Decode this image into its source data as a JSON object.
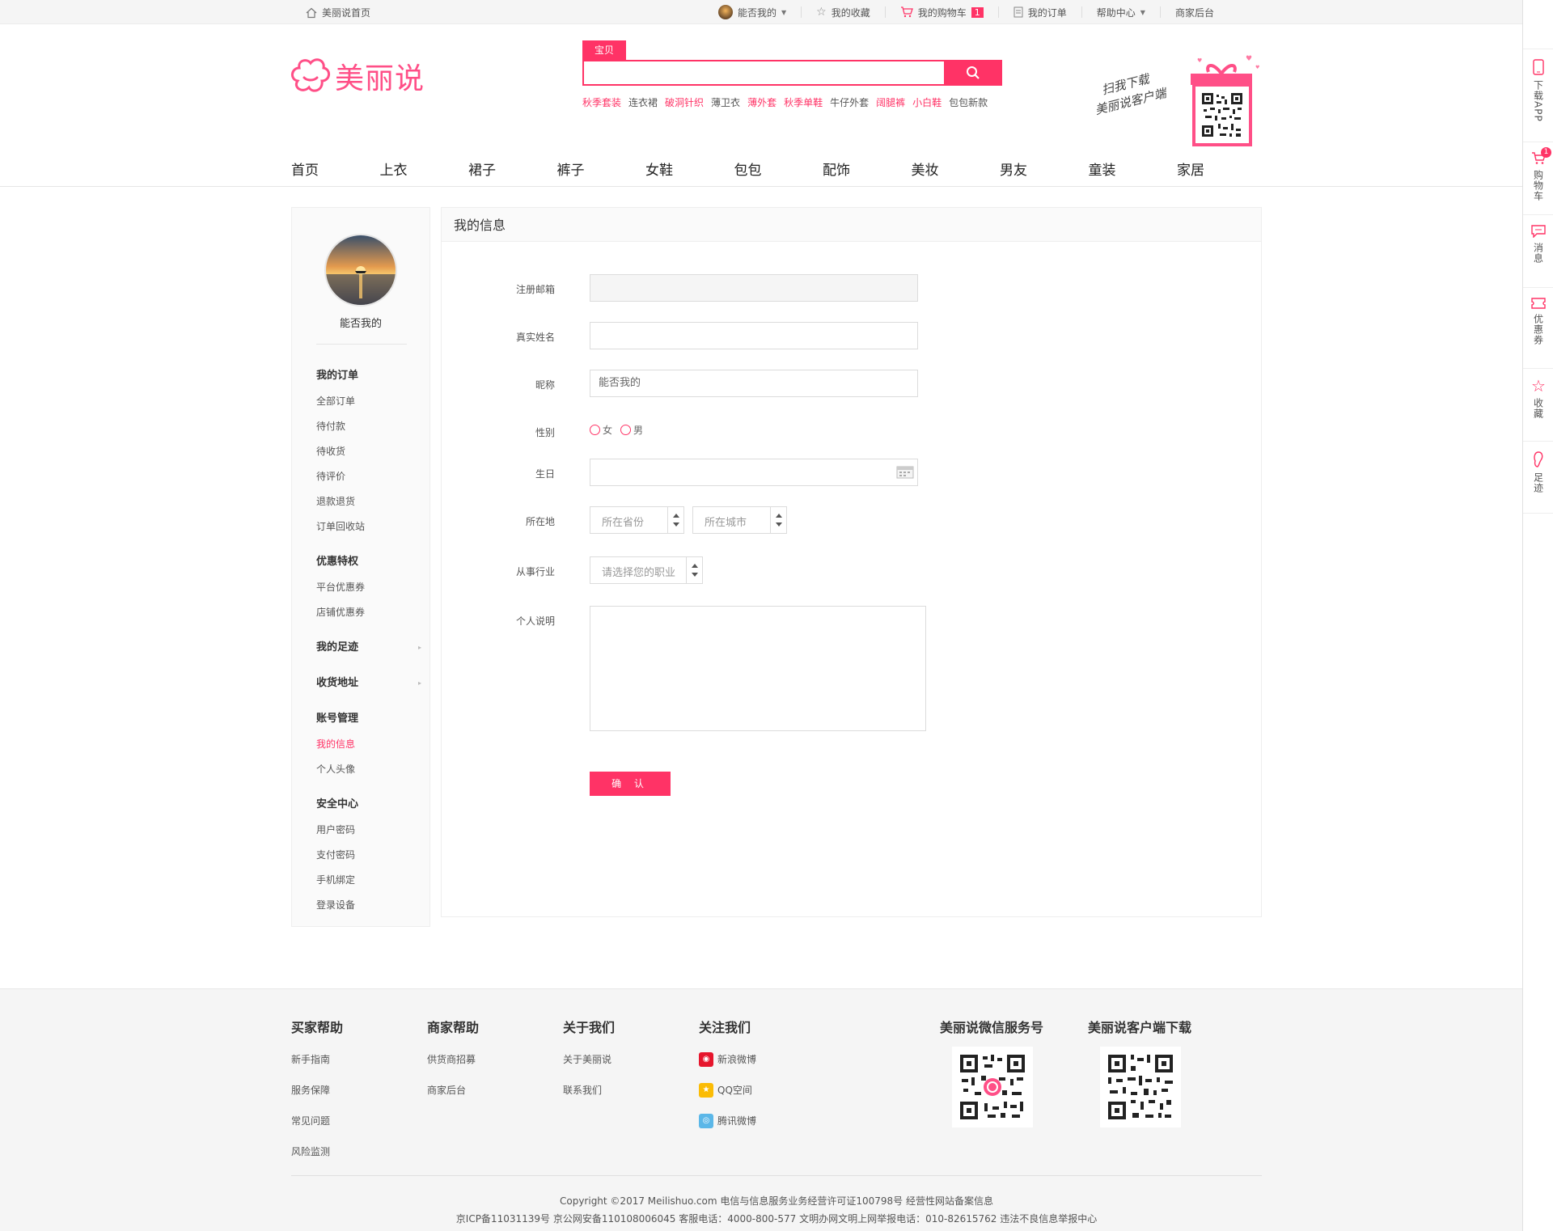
{
  "topbar": {
    "home": "美丽说首页",
    "user": "能否我的",
    "favorites": "我的收藏",
    "cart": "我的购物车",
    "cart_count": "1",
    "orders": "我的订单",
    "help": "帮助中心",
    "merchant": "商家后台"
  },
  "header": {
    "logo_text": "美丽说",
    "search_tab": "宝贝",
    "hotwords": [
      {
        "text": "秋季套装",
        "hot": true
      },
      {
        "text": "连衣裙",
        "hot": false
      },
      {
        "text": "破洞针织",
        "hot": true
      },
      {
        "text": "薄卫衣",
        "hot": false
      },
      {
        "text": "薄外套",
        "hot": true
      },
      {
        "text": "秋季单鞋",
        "hot": true
      },
      {
        "text": "牛仔外套",
        "hot": false
      },
      {
        "text": "阔腿裤",
        "hot": true
      },
      {
        "text": "小白鞋",
        "hot": true
      },
      {
        "text": "包包新款",
        "hot": false
      }
    ],
    "promo_line1": "扫我下载",
    "promo_line2": "美丽说客户端"
  },
  "nav": [
    "首页",
    "上衣",
    "裙子",
    "裤子",
    "女鞋",
    "包包",
    "配饰",
    "美妆",
    "男友",
    "童装",
    "家居"
  ],
  "sidebar": {
    "username": "能否我的",
    "sections": [
      {
        "title": "我的订单",
        "arrow": false,
        "items": [
          "全部订单",
          "待付款",
          "待收货",
          "待评价",
          "退款退货",
          "订单回收站"
        ]
      },
      {
        "title": "优惠特权",
        "arrow": false,
        "items": [
          "平台优惠券",
          "店铺优惠券"
        ]
      },
      {
        "title": "我的足迹",
        "arrow": true,
        "items": []
      },
      {
        "title": "收货地址",
        "arrow": true,
        "items": []
      },
      {
        "title": "账号管理",
        "arrow": false,
        "items": [
          "我的信息",
          "个人头像"
        ]
      },
      {
        "title": "安全中心",
        "arrow": false,
        "items": [
          "用户密码",
          "支付密码",
          "手机绑定",
          "登录设备"
        ]
      }
    ],
    "active_item": "我的信息"
  },
  "form": {
    "title": "我的信息",
    "email_label": "注册邮箱",
    "email_value": "",
    "realname_label": "真实姓名",
    "realname_value": "",
    "nickname_label": "昵称",
    "nickname_value": "能否我的",
    "gender_label": "性别",
    "gender_female": "女",
    "gender_male": "男",
    "birthday_label": "生日",
    "location_label": "所在地",
    "province_placeholder": "所在省份",
    "city_placeholder": "所在城市",
    "industry_label": "从事行业",
    "industry_placeholder": "请选择您的职业",
    "bio_label": "个人说明",
    "confirm": "确 认"
  },
  "rail": [
    {
      "label": "下载APP",
      "icon": "phone-icon"
    },
    {
      "label": "购物车",
      "icon": "cart-icon",
      "badge": "1"
    },
    {
      "label": "消息",
      "icon": "message-icon"
    },
    {
      "label": "优惠券",
      "icon": "coupon-icon"
    },
    {
      "label": "收藏",
      "icon": "star-icon"
    },
    {
      "label": "足迹",
      "icon": "footprint-icon"
    }
  ],
  "footer": {
    "buyer": {
      "title": "买家帮助",
      "items": [
        "新手指南",
        "服务保障",
        "常见问题",
        "风险监测"
      ]
    },
    "seller": {
      "title": "商家帮助",
      "items": [
        "供货商招募",
        "商家后台"
      ]
    },
    "about": {
      "title": "关于我们",
      "items": [
        "关于美丽说",
        "联系我们"
      ]
    },
    "follow": {
      "title": "关注我们",
      "items": [
        "新浪微博",
        "QQ空间",
        "腾讯微博"
      ]
    },
    "wechat_title": "美丽说微信服务号",
    "app_title": "美丽说客户端下载",
    "copyright1": "Copyright ©2017 Meilishuo.com  电信与信息服务业务经营许可证100798号 经营性网站备案信息",
    "copyright2": "京ICP备11031139号  京公网安备110108006045  客服电话：4000-800-577  文明办网文明上网举报电话：010-82615762  违法不良信息举报中心"
  },
  "colors": {
    "accent": "#ff3366",
    "logo": "#ff4f87"
  }
}
